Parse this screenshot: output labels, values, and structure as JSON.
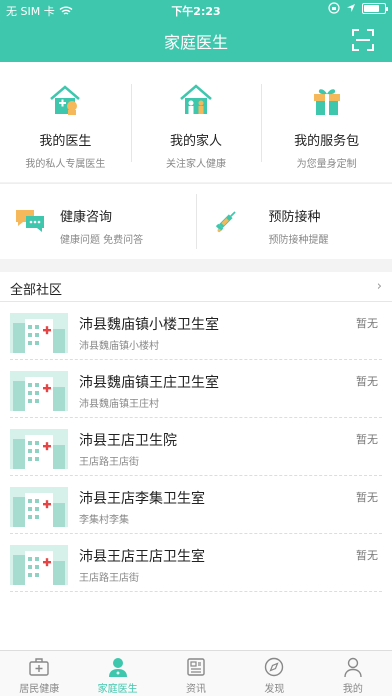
{
  "status_bar": {
    "carrier": "无 SIM 卡",
    "time": "下午2:23",
    "battery_level": 0.75
  },
  "header": {
    "title": "家庭医生",
    "scan_icon": "scan-icon"
  },
  "top_features": [
    {
      "icon": "house-doctor-icon",
      "title": "我的医生",
      "subtitle": "我的私人专属医生"
    },
    {
      "icon": "family-house-icon",
      "title": "我的家人",
      "subtitle": "关注家人健康"
    },
    {
      "icon": "gift-box-icon",
      "title": "我的服务包",
      "subtitle": "为您量身定制"
    }
  ],
  "mid_features": [
    {
      "icon": "chat-bubbles-icon",
      "title": "健康咨询",
      "subtitle": "健康问题 免费问答"
    },
    {
      "icon": "syringe-icon",
      "title": "预防接种",
      "subtitle": "预防接种提醒"
    }
  ],
  "community": {
    "title": "全部社区",
    "items": [
      {
        "name": "沛县魏庙镇小楼卫生室",
        "address": "沛县魏庙镇小楼村",
        "status": "暂无"
      },
      {
        "name": "沛县魏庙镇王庄卫生室",
        "address": "沛县魏庙镇王庄村",
        "status": "暂无"
      },
      {
        "name": "沛县王店卫生院",
        "address": "王店路王店街",
        "status": "暂无"
      },
      {
        "name": "沛县王店李集卫生室",
        "address": "李集村李集",
        "status": "暂无"
      },
      {
        "name": "沛县王店王店卫生室",
        "address": "王店路王店街",
        "status": "暂无"
      }
    ]
  },
  "tabbar": {
    "active_color": "#3fc7ad",
    "items": [
      {
        "label": "居民健康",
        "icon": "medical-kit-icon"
      },
      {
        "label": "家庭医生",
        "icon": "doctor-icon",
        "active": true
      },
      {
        "label": "资讯",
        "icon": "news-icon"
      },
      {
        "label": "发现",
        "icon": "compass-icon"
      },
      {
        "label": "我的",
        "icon": "person-icon"
      }
    ]
  }
}
